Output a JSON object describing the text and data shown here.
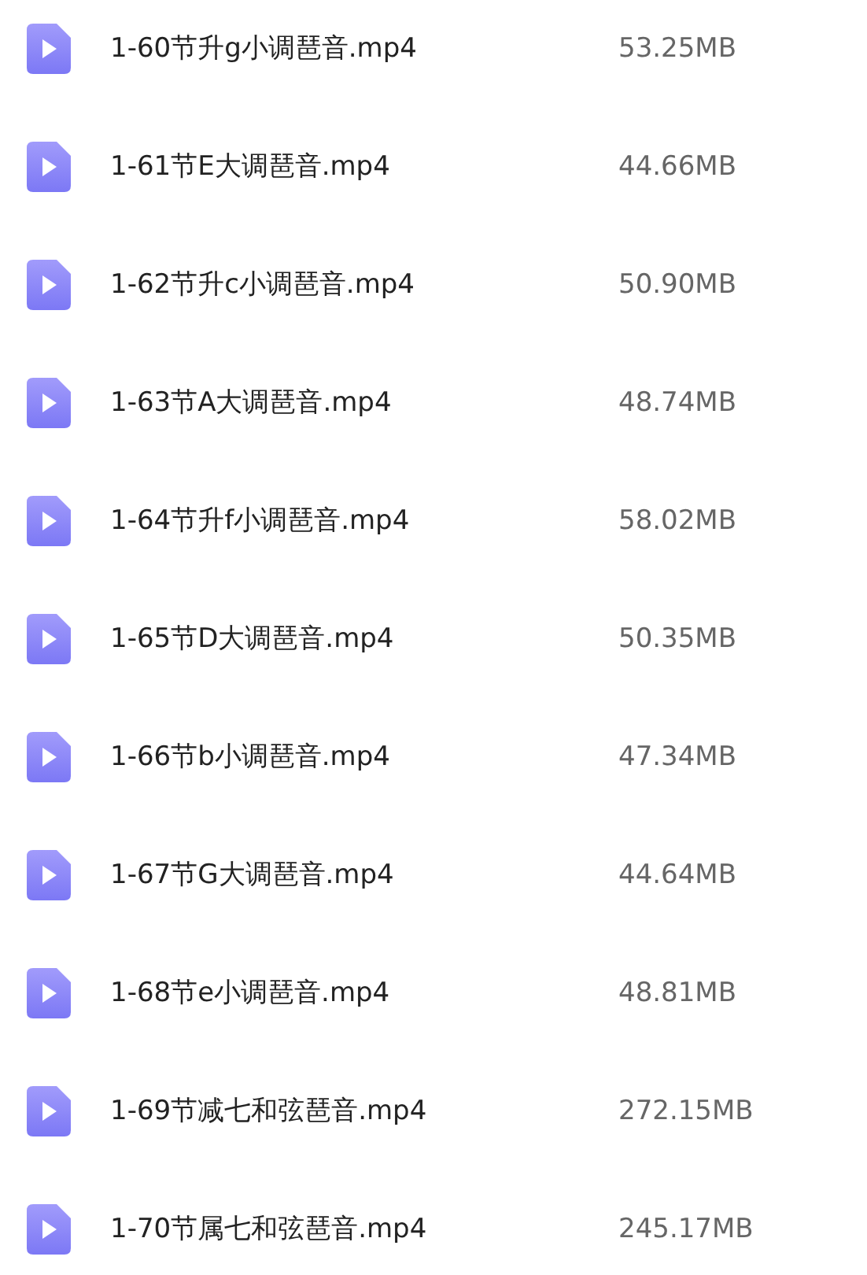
{
  "files": [
    {
      "name": "1-60节升g小调琶音.mp4",
      "size": "53.25MB"
    },
    {
      "name": "1-61节E大调琶音.mp4",
      "size": "44.66MB"
    },
    {
      "name": "1-62节升c小调琶音.mp4",
      "size": "50.90MB"
    },
    {
      "name": "1-63节A大调琶音.mp4",
      "size": "48.74MB"
    },
    {
      "name": "1-64节升f小调琶音.mp4",
      "size": "58.02MB"
    },
    {
      "name": "1-65节D大调琶音.mp4",
      "size": "50.35MB"
    },
    {
      "name": "1-66节b小调琶音.mp4",
      "size": "47.34MB"
    },
    {
      "name": "1-67节G大调琶音.mp4",
      "size": "44.64MB"
    },
    {
      "name": "1-68节e小调琶音.mp4",
      "size": "48.81MB"
    },
    {
      "name": "1-69节减七和弦琶音.mp4",
      "size": "272.15MB"
    },
    {
      "name": "1-70节属七和弦琶音.mp4",
      "size": "245.17MB"
    }
  ]
}
